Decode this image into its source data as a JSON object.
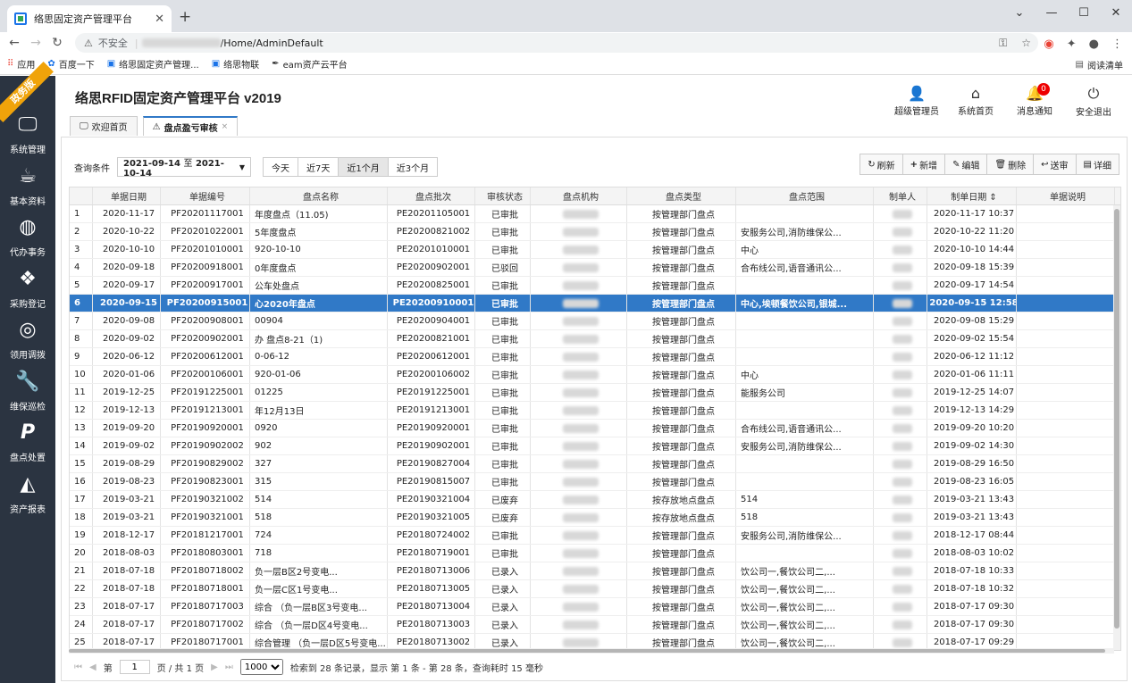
{
  "browser": {
    "tab_title": "络思固定资产管理平台",
    "insecure_label": "不安全",
    "url_path": "/Home/AdminDefault",
    "bookmarks": [
      "应用",
      "百度一下",
      "络思固定资产管理...",
      "络思物联",
      "eam资产云平台"
    ],
    "reading_list": "阅读清单"
  },
  "ribbon": "政务版",
  "sidebar": {
    "items": [
      {
        "label": "系统管理",
        "icon": "monitor-icon"
      },
      {
        "label": "基本资料",
        "icon": "coffee-cup-icon"
      },
      {
        "label": "代办事务",
        "icon": "globe-icon"
      },
      {
        "label": "采购登记",
        "icon": "cubes-icon"
      },
      {
        "label": "领用调拨",
        "icon": "lifebuoy-icon"
      },
      {
        "label": "维保巡检",
        "icon": "wrench-icon"
      },
      {
        "label": "盘点处置",
        "icon": "paypal-icon"
      },
      {
        "label": "资产报表",
        "icon": "area-chart-icon"
      }
    ]
  },
  "header": {
    "title": "络思RFID固定资产管理平台 v2019",
    "tools": [
      {
        "label": "超级管理员",
        "icon": "user-icon"
      },
      {
        "label": "系统首页",
        "icon": "home-icon"
      },
      {
        "label": "消息通知",
        "icon": "bell-icon",
        "badge": "0"
      },
      {
        "label": "安全退出",
        "icon": "power-icon"
      }
    ]
  },
  "page_tabs": [
    {
      "label": "欢迎首页",
      "icon": "monitor-icon"
    },
    {
      "label": "盘点盈亏审核",
      "icon": "warning-icon",
      "close": "×"
    }
  ],
  "filter": {
    "label": "查询条件",
    "start": "2021-09-14",
    "sep": "至",
    "end": "2021-10-14",
    "quick": [
      "今天",
      "近7天",
      "近1个月",
      "近3个月"
    ],
    "quick_selected": "近1个月"
  },
  "actions": [
    "刷新",
    "新增",
    "编辑",
    "删除",
    "送审",
    "详细"
  ],
  "table": {
    "headers": [
      "",
      "单据日期",
      "单据编号",
      "盘点名称",
      "盘点批次",
      "审核状态",
      "盘点机构",
      "盘点类型",
      "盘点范围",
      "制单人",
      "制单日期 ⇕",
      "单据说明"
    ],
    "selected_index": 5,
    "rows": [
      [
        "1",
        "2020-11-17",
        "PF20201117001",
        "  年度盘点（11.05)",
        "PE20201105001",
        "已审批",
        "",
        "按管理部门盘点",
        "",
        "",
        "2020-11-17 10:37",
        ""
      ],
      [
        "2",
        "2020-10-22",
        "PF20201022001",
        "  5年度盘点",
        "PE20200821002",
        "已审批",
        "",
        "按管理部门盘点",
        "安服务公司,消防维保公...",
        "",
        "2020-10-22 11:20",
        ""
      ],
      [
        "3",
        "2020-10-10",
        "PF20201010001",
        "  920-10-10",
        "PE20201010001",
        "已审批",
        "",
        "按管理部门盘点",
        "  中心",
        "",
        "2020-10-10 14:44",
        ""
      ],
      [
        "4",
        "2020-09-18",
        "PF20200918001",
        "  0年度盘点",
        "PE20200902001",
        "已驳回",
        "",
        "按管理部门盘点",
        "合布线公司,语音通讯公...",
        "",
        "2020-09-18 15:39",
        ""
      ],
      [
        "5",
        "2020-09-17",
        "PF20200917001",
        "  公车处盘点",
        "PE20200825001",
        "已审批",
        "",
        "按管理部门盘点",
        "",
        "",
        "2020-09-17 14:54",
        ""
      ],
      [
        "6",
        "2020-09-15",
        "PF20200915001",
        "  心2020年盘点",
        "PE20200910001",
        "已审批",
        "",
        "按管理部门盘点",
        "中心,埃顿餐饮公司,银城...",
        "",
        "2020-09-15 12:58",
        ""
      ],
      [
        "7",
        "2020-09-08",
        "PF20200908001",
        "  00904",
        "PE20200904001",
        "已审批",
        "",
        "按管理部门盘点",
        "",
        "",
        "2020-09-08 15:29",
        ""
      ],
      [
        "8",
        "2020-09-02",
        "PF20200902001",
        "办  盘点8-21（1)",
        "PE20200821001",
        "已审批",
        "",
        "按管理部门盘点",
        "",
        "",
        "2020-09-02 15:54",
        ""
      ],
      [
        "9",
        "2020-06-12",
        "PF20200612001",
        "  0-06-12",
        "PE20200612001",
        "已审批",
        "",
        "按管理部门盘点",
        "",
        "",
        "2020-06-12 11:12",
        ""
      ],
      [
        "10",
        "2020-01-06",
        "PF20200106001",
        "  920-01-06",
        "PE20200106002",
        "已审批",
        "",
        "按管理部门盘点",
        "  中心",
        "",
        "2020-01-06 11:11",
        ""
      ],
      [
        "11",
        "2019-12-25",
        "PF20191225001",
        "  01225",
        "PE20191225001",
        "已审批",
        "",
        "按管理部门盘点",
        "  能服务公司",
        "",
        "2019-12-25 14:07",
        ""
      ],
      [
        "12",
        "2019-12-13",
        "PF20191213001",
        "  年12月13日",
        "PE20191213001",
        "已审批",
        "",
        "按管理部门盘点",
        "",
        "",
        "2019-12-13 14:29",
        ""
      ],
      [
        "13",
        "2019-09-20",
        "PF20190920001",
        "  0920",
        "PE20190920001",
        "已审批",
        "",
        "按管理部门盘点",
        "合布线公司,语音通讯公...",
        "",
        "2019-09-20 10:20",
        ""
      ],
      [
        "14",
        "2019-09-02",
        "PF20190902002",
        "  902",
        "PE20190902001",
        "已审批",
        "",
        "按管理部门盘点",
        "安服务公司,消防维保公...",
        "",
        "2019-09-02 14:30",
        ""
      ],
      [
        "15",
        "2019-08-29",
        "PF20190829002",
        "  327",
        "PE20190827004",
        "已审批",
        "",
        "按管理部门盘点",
        "",
        "",
        "2019-08-29 16:50",
        ""
      ],
      [
        "16",
        "2019-08-23",
        "PF20190823001",
        "  315",
        "PE20190815007",
        "已审批",
        "",
        "按管理部门盘点",
        "",
        "",
        "2019-08-23 16:05",
        ""
      ],
      [
        "17",
        "2019-03-21",
        "PF20190321002",
        "  514",
        "PE20190321004",
        "已废弃",
        "",
        "按存放地点盘点",
        "  514",
        "",
        "2019-03-21 13:43",
        ""
      ],
      [
        "18",
        "2019-03-21",
        "PF20190321001",
        "  518",
        "PE20190321005",
        "已废弃",
        "",
        "按存放地点盘点",
        "  518",
        "",
        "2019-03-21 13:43",
        ""
      ],
      [
        "19",
        "2018-12-17",
        "PF20181217001",
        "  724",
        "PE20180724002",
        "已审批",
        "",
        "按管理部门盘点",
        "安服务公司,消防维保公...",
        "",
        "2018-12-17 08:44",
        ""
      ],
      [
        "20",
        "2018-08-03",
        "PF20180803001",
        "  718",
        "PE20180719001",
        "已审批",
        "",
        "按管理部门盘点",
        "",
        "",
        "2018-08-03 10:02",
        ""
      ],
      [
        "21",
        "2018-07-18",
        "PF20180718002",
        "  负一层B区2号变电...",
        "PE20180713006",
        "已录入",
        "",
        "按管理部门盘点",
        "饮公司一,餐饮公司二,...",
        "",
        "2018-07-18 10:33",
        ""
      ],
      [
        "22",
        "2018-07-18",
        "PF20180718001",
        "  负一层C区1号变电...",
        "PE20180713005",
        "已录入",
        "",
        "按管理部门盘点",
        "饮公司一,餐饮公司二,...",
        "",
        "2018-07-18 10:32",
        ""
      ],
      [
        "23",
        "2018-07-17",
        "PF20180717003",
        "综合  （负一层B区3号变电...",
        "PE20180713004",
        "已录入",
        "",
        "按管理部门盘点",
        "饮公司一,餐饮公司二,...",
        "",
        "2018-07-17 09:30",
        ""
      ],
      [
        "24",
        "2018-07-17",
        "PF20180717002",
        "综合  （负一层D区4号变电...",
        "PE20180713003",
        "已录入",
        "",
        "按管理部门盘点",
        "饮公司一,餐饮公司二,...",
        "",
        "2018-07-17 09:30",
        ""
      ],
      [
        "25",
        "2018-07-17",
        "PF20180717001",
        "综合管理  （负一层D区5号变电...",
        "PE20180713002",
        "已录入",
        "",
        "按管理部门盘点",
        "饮公司一,餐饮公司二,...",
        "",
        "2018-07-17 09:29",
        ""
      ]
    ]
  },
  "pager": {
    "page_label": "第",
    "page_value": "1",
    "total": "页 / 共 1 页",
    "page_size": "1000",
    "summary": "检索到 28 条记录，显示 第 1 条 - 第 28 条，查询耗时 15 毫秒"
  }
}
